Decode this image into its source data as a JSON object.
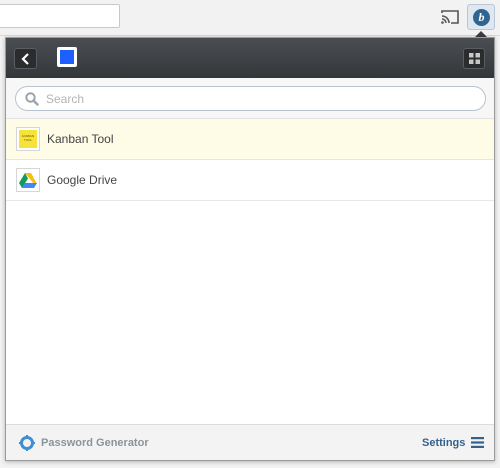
{
  "browser": {
    "address_value": "",
    "extension_letter": "b"
  },
  "search": {
    "placeholder": "Search",
    "value": ""
  },
  "sites": [
    {
      "label": "Kanban Tool",
      "icon": "kanban-tool-logo",
      "selected": true,
      "logo_text": "KANBAN TOOL"
    },
    {
      "label": "Google Drive",
      "icon": "google-drive-logo",
      "selected": false
    }
  ],
  "footer": {
    "password_generator_label": "Password Generator",
    "settings_label": "Settings"
  },
  "colors": {
    "header_bg": "#3f4245",
    "vault_blue": "#1e5fff",
    "selected_row": "#fefbe6",
    "link_blue": "#35618c",
    "muted_link": "#8a949c"
  }
}
